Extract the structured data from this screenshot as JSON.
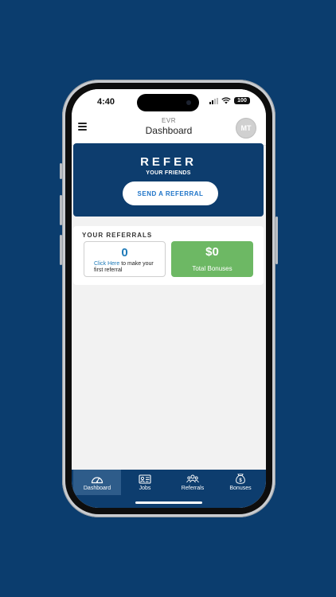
{
  "status_bar": {
    "time": "4:40",
    "battery": "100"
  },
  "header": {
    "brand": "EVR",
    "title": "Dashboard",
    "avatar_initials": "MT"
  },
  "refer": {
    "title": "REFER",
    "subtitle": "YOUR FRIENDS",
    "button_label": "SEND A REFERRAL"
  },
  "referrals": {
    "heading": "YOUR REFERRALS",
    "count": "0",
    "link_text": "Click Here",
    "message": " to make your first referral",
    "bonus_amount": "$0",
    "bonus_label": "Total Bonuses"
  },
  "tabs": [
    {
      "label": "Dashboard",
      "icon": "gauge-icon",
      "active": true
    },
    {
      "label": "Jobs",
      "icon": "id-card-icon",
      "active": false
    },
    {
      "label": "Referrals",
      "icon": "people-icon",
      "active": false
    },
    {
      "label": "Bonuses",
      "icon": "money-bag-icon",
      "active": false
    }
  ],
  "colors": {
    "background": "#0b3d6e",
    "primary": "#0d3d6e",
    "link": "#1e7ab8",
    "bonus_green": "#6db864",
    "tab_active": "#2e5c8a"
  }
}
